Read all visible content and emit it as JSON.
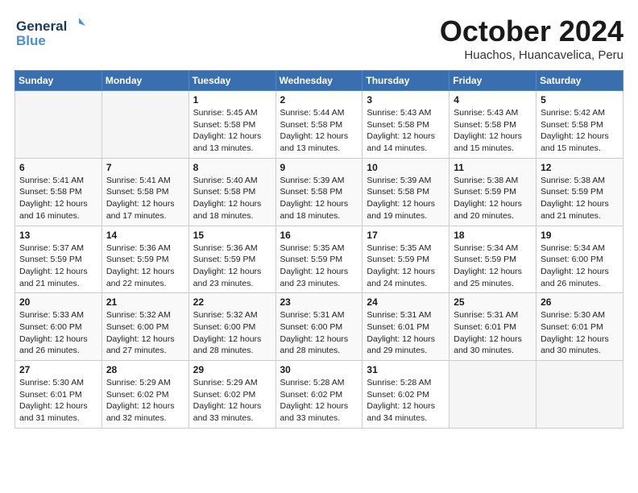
{
  "logo": {
    "line1": "General",
    "line2": "Blue"
  },
  "title": "October 2024",
  "location": "Huachos, Huancavelica, Peru",
  "weekdays": [
    "Sunday",
    "Monday",
    "Tuesday",
    "Wednesday",
    "Thursday",
    "Friday",
    "Saturday"
  ],
  "weeks": [
    [
      {
        "num": "",
        "info": ""
      },
      {
        "num": "",
        "info": ""
      },
      {
        "num": "1",
        "info": "Sunrise: 5:45 AM\nSunset: 5:58 PM\nDaylight: 12 hours\nand 13 minutes."
      },
      {
        "num": "2",
        "info": "Sunrise: 5:44 AM\nSunset: 5:58 PM\nDaylight: 12 hours\nand 13 minutes."
      },
      {
        "num": "3",
        "info": "Sunrise: 5:43 AM\nSunset: 5:58 PM\nDaylight: 12 hours\nand 14 minutes."
      },
      {
        "num": "4",
        "info": "Sunrise: 5:43 AM\nSunset: 5:58 PM\nDaylight: 12 hours\nand 15 minutes."
      },
      {
        "num": "5",
        "info": "Sunrise: 5:42 AM\nSunset: 5:58 PM\nDaylight: 12 hours\nand 15 minutes."
      }
    ],
    [
      {
        "num": "6",
        "info": "Sunrise: 5:41 AM\nSunset: 5:58 PM\nDaylight: 12 hours\nand 16 minutes."
      },
      {
        "num": "7",
        "info": "Sunrise: 5:41 AM\nSunset: 5:58 PM\nDaylight: 12 hours\nand 17 minutes."
      },
      {
        "num": "8",
        "info": "Sunrise: 5:40 AM\nSunset: 5:58 PM\nDaylight: 12 hours\nand 18 minutes."
      },
      {
        "num": "9",
        "info": "Sunrise: 5:39 AM\nSunset: 5:58 PM\nDaylight: 12 hours\nand 18 minutes."
      },
      {
        "num": "10",
        "info": "Sunrise: 5:39 AM\nSunset: 5:58 PM\nDaylight: 12 hours\nand 19 minutes."
      },
      {
        "num": "11",
        "info": "Sunrise: 5:38 AM\nSunset: 5:59 PM\nDaylight: 12 hours\nand 20 minutes."
      },
      {
        "num": "12",
        "info": "Sunrise: 5:38 AM\nSunset: 5:59 PM\nDaylight: 12 hours\nand 21 minutes."
      }
    ],
    [
      {
        "num": "13",
        "info": "Sunrise: 5:37 AM\nSunset: 5:59 PM\nDaylight: 12 hours\nand 21 minutes."
      },
      {
        "num": "14",
        "info": "Sunrise: 5:36 AM\nSunset: 5:59 PM\nDaylight: 12 hours\nand 22 minutes."
      },
      {
        "num": "15",
        "info": "Sunrise: 5:36 AM\nSunset: 5:59 PM\nDaylight: 12 hours\nand 23 minutes."
      },
      {
        "num": "16",
        "info": "Sunrise: 5:35 AM\nSunset: 5:59 PM\nDaylight: 12 hours\nand 23 minutes."
      },
      {
        "num": "17",
        "info": "Sunrise: 5:35 AM\nSunset: 5:59 PM\nDaylight: 12 hours\nand 24 minutes."
      },
      {
        "num": "18",
        "info": "Sunrise: 5:34 AM\nSunset: 5:59 PM\nDaylight: 12 hours\nand 25 minutes."
      },
      {
        "num": "19",
        "info": "Sunrise: 5:34 AM\nSunset: 6:00 PM\nDaylight: 12 hours\nand 26 minutes."
      }
    ],
    [
      {
        "num": "20",
        "info": "Sunrise: 5:33 AM\nSunset: 6:00 PM\nDaylight: 12 hours\nand 26 minutes."
      },
      {
        "num": "21",
        "info": "Sunrise: 5:32 AM\nSunset: 6:00 PM\nDaylight: 12 hours\nand 27 minutes."
      },
      {
        "num": "22",
        "info": "Sunrise: 5:32 AM\nSunset: 6:00 PM\nDaylight: 12 hours\nand 28 minutes."
      },
      {
        "num": "23",
        "info": "Sunrise: 5:31 AM\nSunset: 6:00 PM\nDaylight: 12 hours\nand 28 minutes."
      },
      {
        "num": "24",
        "info": "Sunrise: 5:31 AM\nSunset: 6:01 PM\nDaylight: 12 hours\nand 29 minutes."
      },
      {
        "num": "25",
        "info": "Sunrise: 5:31 AM\nSunset: 6:01 PM\nDaylight: 12 hours\nand 30 minutes."
      },
      {
        "num": "26",
        "info": "Sunrise: 5:30 AM\nSunset: 6:01 PM\nDaylight: 12 hours\nand 30 minutes."
      }
    ],
    [
      {
        "num": "27",
        "info": "Sunrise: 5:30 AM\nSunset: 6:01 PM\nDaylight: 12 hours\nand 31 minutes."
      },
      {
        "num": "28",
        "info": "Sunrise: 5:29 AM\nSunset: 6:02 PM\nDaylight: 12 hours\nand 32 minutes."
      },
      {
        "num": "29",
        "info": "Sunrise: 5:29 AM\nSunset: 6:02 PM\nDaylight: 12 hours\nand 33 minutes."
      },
      {
        "num": "30",
        "info": "Sunrise: 5:28 AM\nSunset: 6:02 PM\nDaylight: 12 hours\nand 33 minutes."
      },
      {
        "num": "31",
        "info": "Sunrise: 5:28 AM\nSunset: 6:02 PM\nDaylight: 12 hours\nand 34 minutes."
      },
      {
        "num": "",
        "info": ""
      },
      {
        "num": "",
        "info": ""
      }
    ]
  ]
}
